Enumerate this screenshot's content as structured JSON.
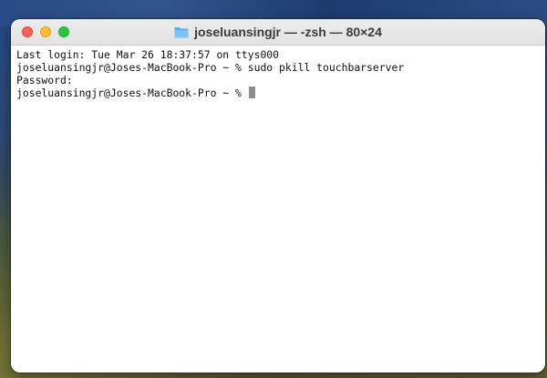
{
  "window": {
    "title": "joseluansingjr — -zsh — 80×24",
    "folder_icon": "folder-icon",
    "controls": {
      "close_color": "#fe5f57",
      "minimize_color": "#febc2e",
      "maximize_color": "#28c840"
    }
  },
  "terminal": {
    "lines": [
      "Last login: Tue Mar 26 18:37:57 on ttys000",
      "joseluansingjr@Joses-MacBook-Pro ~ % sudo pkill touchbarserver",
      "Password:",
      "joseluansingjr@Joses-MacBook-Pro ~ % "
    ],
    "cursor_icon": "block-cursor"
  }
}
